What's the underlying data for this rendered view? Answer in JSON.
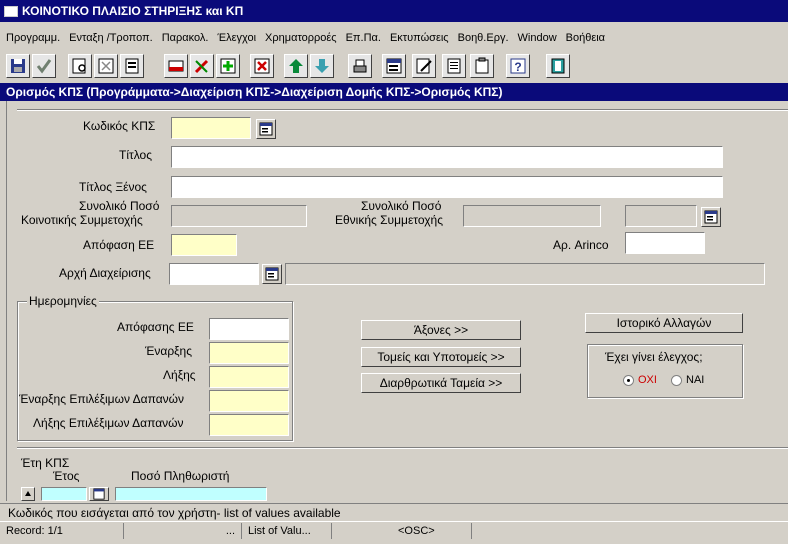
{
  "window": {
    "title": "ΚΟΙΝΟΤΙΚΟ ΠΛΑΙΣΙΟ ΣΤΗΡΙΞΗΣ και ΚΠ"
  },
  "menu": [
    "Προγραμμ.",
    "Ενταξη /Τροποπ.",
    "Παρακολ.",
    "Έλεγχοι",
    "Χρηματορροές",
    "Επ.Πα.",
    "Εκτυπώσεις",
    "Βοηθ.Εργ.",
    "Window",
    "Βοήθεια"
  ],
  "toolbar": {
    "icons": [
      "save-icon",
      "check-icon",
      "query-icon",
      "clear-query-icon",
      "records-icon",
      "print-form-icon",
      "edit-icon",
      "add-record-icon",
      "delete-record-icon",
      "arrow-up-icon",
      "arrow-down-icon",
      "printer-icon",
      "list-icon",
      "pen-icon",
      "document-icon",
      "clipboard-icon",
      "help-icon",
      "exit-icon"
    ]
  },
  "form": {
    "header": "Ορισμός ΚΠΣ (Προγράμματα->Διαχείριση ΚΠΣ->Διαχείριση Δομής ΚΠΣ->Ορισμός ΚΠΣ)",
    "kps_code_label": "Κωδικός ΚΠΣ",
    "kps_code_value": "",
    "title_label": "Τίτλος",
    "title_value": "",
    "foreign_title_label": "Τίτλος Ξένος",
    "foreign_title_value": "",
    "total_eu_label_1": "Συνολικό Ποσό",
    "total_eu_label_2": "Κοινοτικής Συμμετοχής",
    "total_eu_value": "",
    "total_nat_label_1": "Συνολικό Ποσό",
    "total_nat_label_2": "Εθνικής Συμμετοχής",
    "total_nat_value": "",
    "extra_value": "",
    "ee_decision_label": "Απόφαση ΕΕ",
    "ee_decision_value": "",
    "arinco_label": "Αρ. Arinco",
    "arinco_value": "",
    "management_label": "Αρχή Διαχείρισης",
    "management_code": "",
    "management_desc": ""
  },
  "dates": {
    "legend": "Ημερομηνίες",
    "ee_decision_label": "Απόφασης ΕΕ",
    "ee_decision_value": "",
    "start_label": "Έναρξης",
    "start_value": "",
    "end_label": "Λήξης",
    "end_value": "",
    "eligible_start_label": "Έναρξης Επιλέξιμων Δαπανών",
    "eligible_start_value": "",
    "eligible_end_label": "Λήξης  Επιλέξιμων Δαπανών",
    "eligible_end_value": ""
  },
  "buttons": {
    "axes": "Άξονες >>",
    "sectors": "Τομείς και Υποτομείς >>",
    "funds": "Διαρθρωτικά Ταμεία >>",
    "history": "Ιστορικό Αλλαγών"
  },
  "check": {
    "label": "Έχει γίνει έλεγχος;",
    "no": "ΟΧΙ",
    "yes": "ΝΑΙ",
    "selected": "no"
  },
  "years": {
    "legend": "Έτη ΚΠΣ",
    "year_header": "Έτος",
    "amount_header": "Ποσό Πληθωριστή",
    "year_value": "",
    "amount_value": ""
  },
  "status": {
    "hint": "Κωδικός που εισάγεται από τον χρήστη- list of values available",
    "record": "Record: 1/1",
    "dots": "...",
    "lov": "List of Valu...",
    "osc": "<OSC>"
  }
}
